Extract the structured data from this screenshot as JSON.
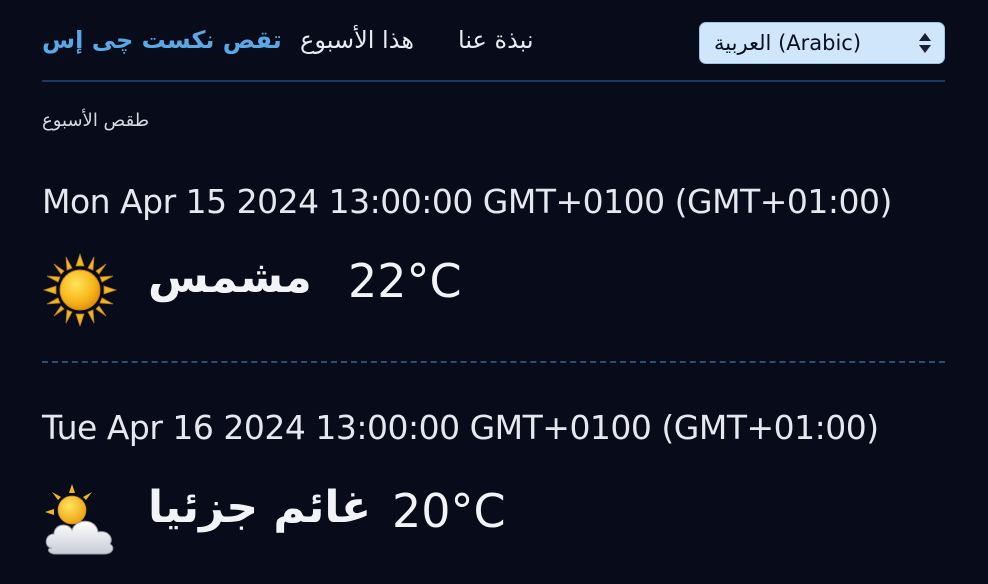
{
  "nav": {
    "brand": "تقص نكست چی إس",
    "links": [
      "هذا الأسبوع",
      "نبذة عنا"
    ],
    "language_select": {
      "selected": "العربية (Arabic)"
    }
  },
  "main": {
    "section_title": "طقص الأسبوع",
    "forecasts": [
      {
        "date": "Mon Apr 15 2024 13:00:00 GMT+0100 (GMT+01:00)",
        "icon": "sun-icon",
        "condition": "مشمس",
        "temperature": "22°C"
      },
      {
        "date": "Tue Apr 16 2024 13:00:00 GMT+0100 (GMT+01:00)",
        "icon": "partly-cloudy-icon",
        "condition": "غائم جزئيا",
        "temperature": "20°C"
      }
    ]
  },
  "colors": {
    "background": "#070b1a",
    "brand": "#5aa8e6",
    "divider": "#1e3a5f",
    "select_bg": "#cfe6fb"
  }
}
